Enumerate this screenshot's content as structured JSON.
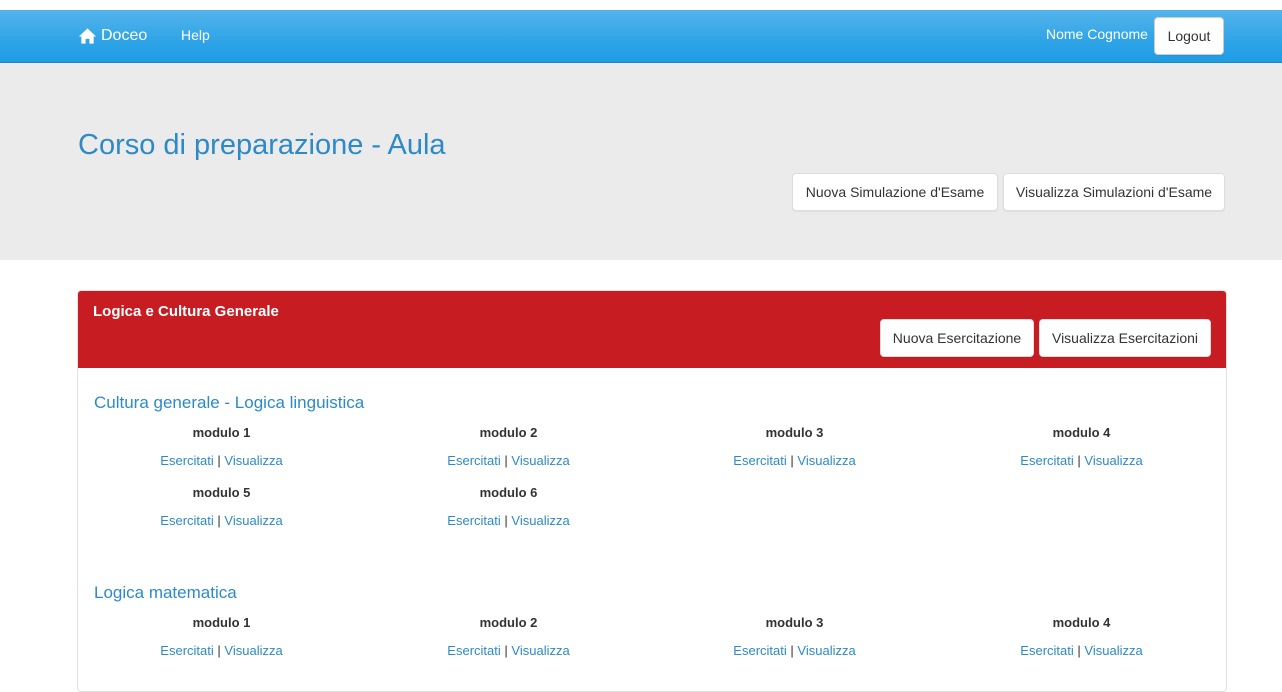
{
  "navbar": {
    "brand": "Doceo",
    "help": "Help",
    "user": "Nome Cognome",
    "logout": "Logout"
  },
  "header": {
    "title": "Corso di preparazione - Aula",
    "btn_new_sim": "Nuova Simulazione d'Esame",
    "btn_view_sim": "Visualizza Simulazioni d'Esame"
  },
  "panel": {
    "title": "Logica e Cultura Generale",
    "btn_new_ex": "Nuova Esercitazione",
    "btn_view_ex": "Visualizza Esercitazioni",
    "sections": [
      {
        "title": "Cultura generale - Logica linguistica",
        "modules": [
          "modulo 1",
          "modulo 2",
          "modulo 3",
          "modulo 4",
          "modulo 5",
          "modulo 6"
        ]
      },
      {
        "title": "Logica matematica",
        "modules": [
          "modulo 1",
          "modulo 2",
          "modulo 3",
          "modulo 4"
        ]
      }
    ],
    "link_practice": "Esercitati",
    "link_sep": "|",
    "link_view": "Visualizza"
  },
  "colors": {
    "navbar": "#2fa4e7",
    "panel_heading": "#c71c22",
    "link": "#2d8ac7",
    "jumbotron": "#ebebeb"
  },
  "icons": {
    "brand": "home-icon"
  }
}
